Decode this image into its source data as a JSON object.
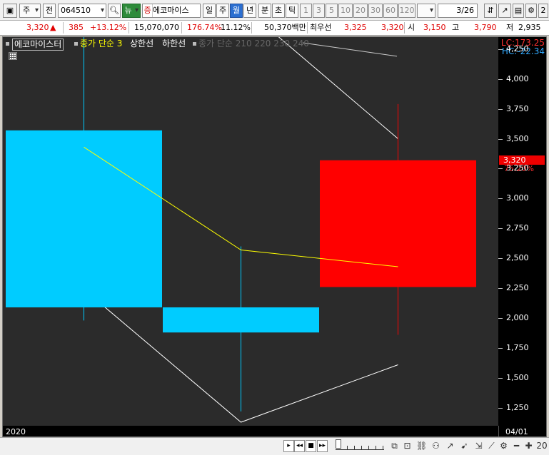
{
  "toolbar": {
    "period_type": "주",
    "prefix_label": "전",
    "code": "064510",
    "news_label": "뉴",
    "stock_name": "에코마이스",
    "stock_badge": "증",
    "periods": [
      "일",
      "주",
      "월",
      "년",
      "분",
      "초",
      "틱"
    ],
    "selected_period": "월",
    "multipliers": [
      "1",
      "3",
      "5",
      "10",
      "20",
      "30",
      "60",
      "120"
    ],
    "page_counter": "3/26"
  },
  "quote": {
    "price": "3,320",
    "change": "385",
    "change_pct": "+13.12%",
    "volume": "15,070,070",
    "volume_ratio": "176.74%",
    "turnover_ratio": "11.12%",
    "amount": "50,370백만",
    "priority_label": "최우선",
    "ask": "3,325",
    "bid": "3,320",
    "open_label": "시",
    "open": "3,150",
    "high_label": "고",
    "high": "3,790",
    "low_label": "저",
    "low": "2,935"
  },
  "chart": {
    "legend": {
      "name": "에코마이스터",
      "ma": "종가 단순 3",
      "upper": "상한선",
      "lower": "하한선",
      "ma_multi": "종가 단순 210  220  230  240"
    },
    "lc_label": "LC:173.25",
    "hc_label": "HC:-22.34",
    "last_price": "3,320",
    "last_pct": "75.20%",
    "x_left_label": "2020",
    "x_right_label": "04/01",
    "colors": {
      "up": "#ff0000",
      "down": "#00ccff",
      "ma": "#ffff00",
      "band": "#ffffff",
      "bg": "#2b2b2b"
    }
  },
  "chart_data": {
    "type": "candlestick",
    "y_ticks": [
      1250,
      1500,
      1750,
      2000,
      2250,
      2500,
      2750,
      3000,
      3250,
      3500,
      3750,
      4000,
      4250
    ],
    "ylim": [
      1100,
      4350
    ],
    "candles": [
      {
        "open": 3570,
        "close": 2090,
        "high": 4620,
        "low": 1980
      },
      {
        "open": 2090,
        "close": 1880,
        "high": 2600,
        "low": 1220
      },
      {
        "open": 2260,
        "close": 3320,
        "high": 3790,
        "low": 1860
      }
    ],
    "ma3": [
      3430,
      2570,
      2430
    ],
    "upper_band": [
      4800,
      4620,
      3500
    ],
    "lower_band": [
      2240,
      1130,
      1610
    ],
    "upper_tail_end": 4190
  },
  "bottom": {
    "buttons": [
      "▸",
      "◂◂",
      "■",
      "▸▸"
    ],
    "icons": [
      "copy-icon",
      "zoom-icon",
      "chain-icon",
      "link-icon",
      "settings-icon",
      "minus-icon",
      "plus-icon"
    ],
    "right_label": "20"
  }
}
